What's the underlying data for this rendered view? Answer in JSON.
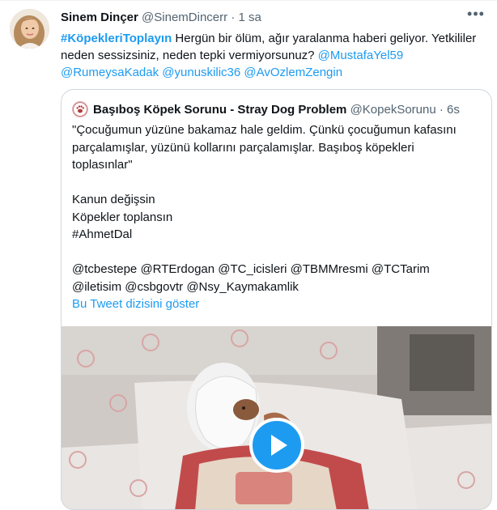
{
  "tweet": {
    "author_name": "Sinem Dinçer",
    "author_handle": "@SinemDincerr",
    "separator": "·",
    "time": "1 sa",
    "more_icon": "more-icon",
    "hashtag": "#KöpekleriToplayın",
    "body_1": " Hergün bir ölüm, ağır yaralanma haberi geliyor. Yetkililer neden sessizsiniz, neden tepki vermiyorsunuz? ",
    "mention_1": "@MustafaYel59",
    "mention_2": "@RumeysaKadak",
    "mention_3": "@yunuskilic36",
    "mention_4": "@AvOzlemZengin"
  },
  "quote": {
    "author_name": "Başıboş Köpek Sorunu - Stray Dog Problem",
    "author_handle": "@KopekSorunu",
    "separator": "·",
    "time": "6s",
    "lines": [
      "\"Çocuğumun yüzüne bakamaz hale geldim. Çünkü çocuğumun kafasını",
      "parçalamışlar, yüzünü kollarını parçalamışlar. Başıboş köpekleri",
      "toplasınlar\"",
      "",
      "Kanun değişsin",
      "Köpekler toplansın",
      "#AhmetDal",
      "",
      "@tcbestepe @RTErdogan @TC_icisleri @TBMMresmi @TCTarim",
      "@iletisim @csbgovtr @Nsy_Kaymakamlik"
    ],
    "show_thread": "Bu Tweet dizisini göster",
    "media_icon": "play-icon"
  }
}
